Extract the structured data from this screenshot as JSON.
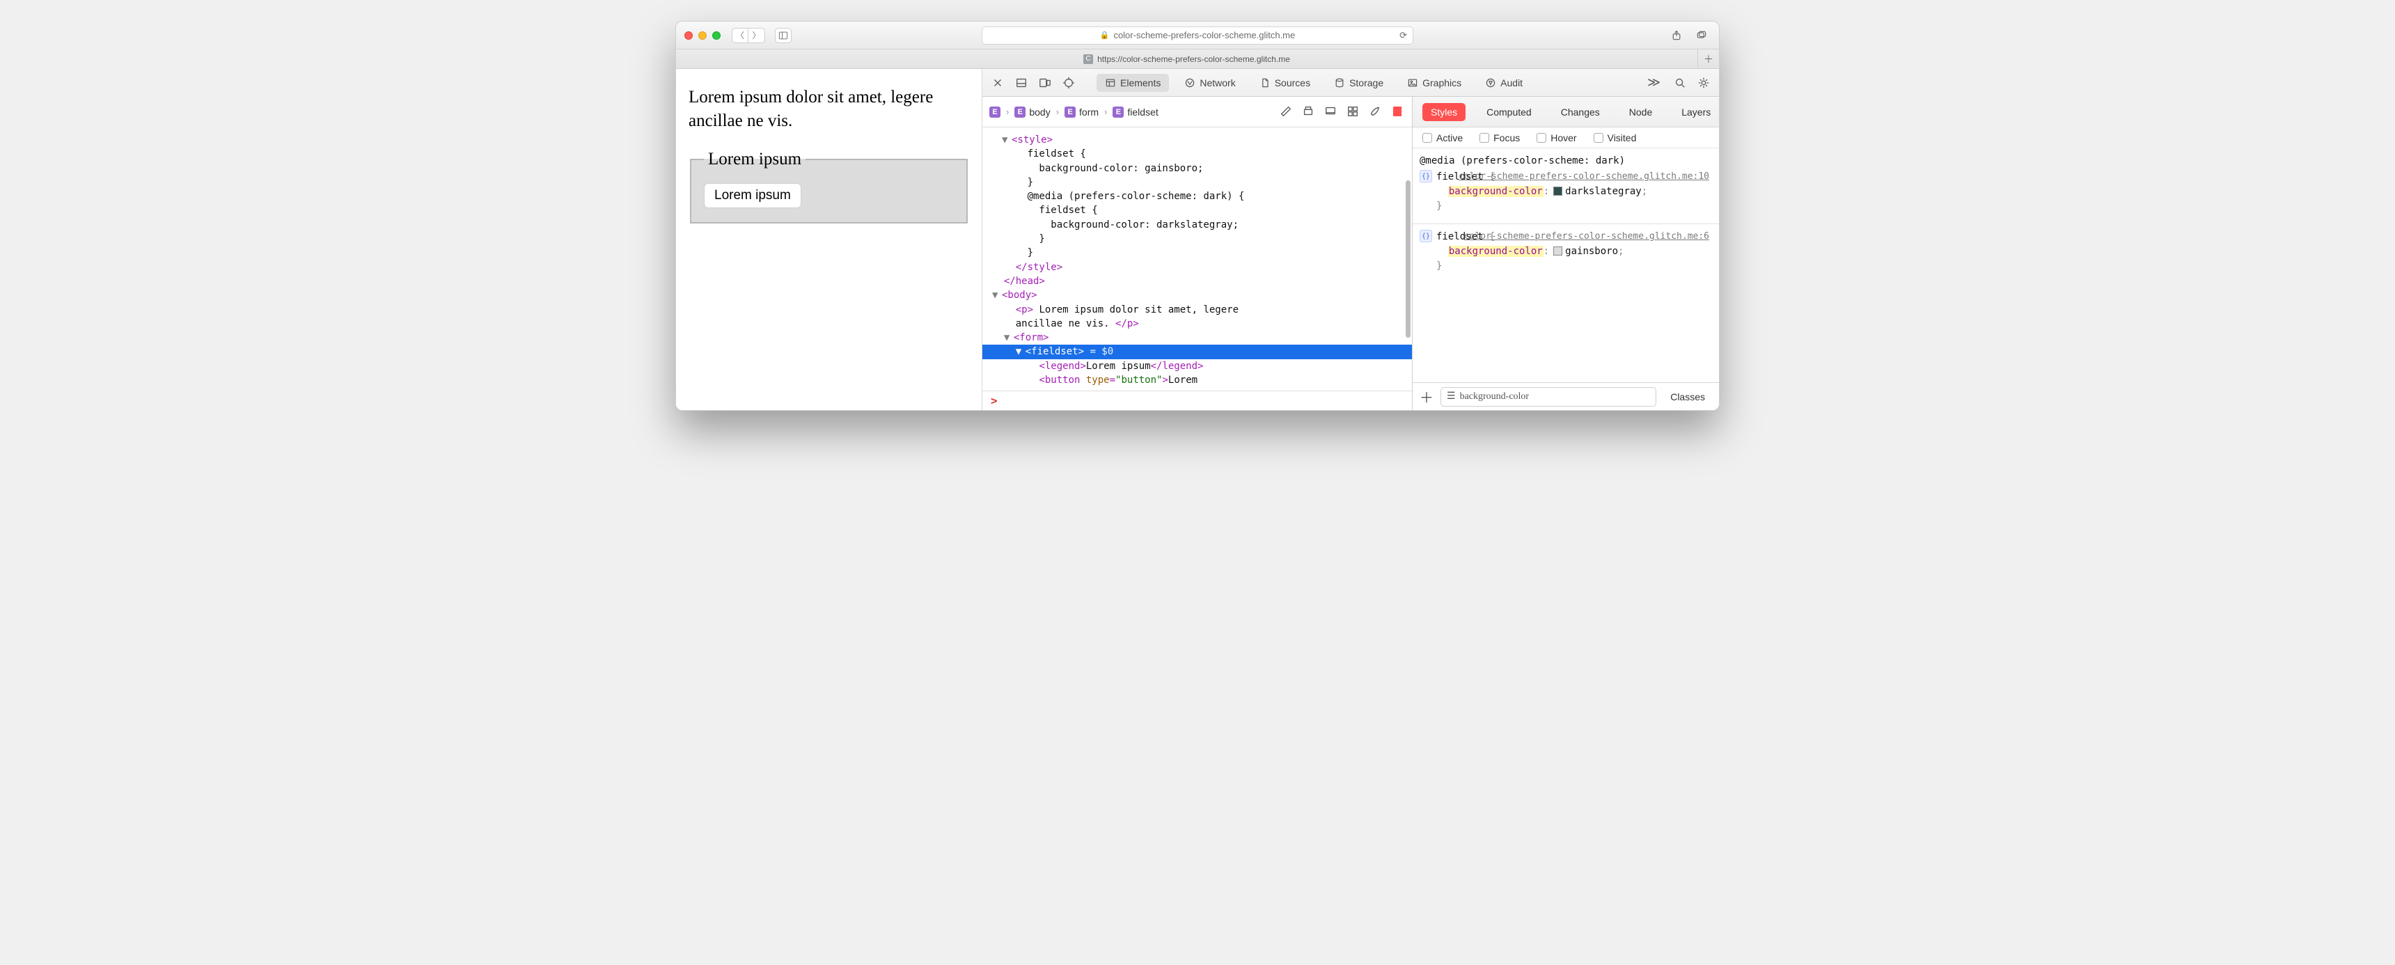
{
  "titlebar": {
    "url_host": "color-scheme-prefers-color-scheme.glitch.me"
  },
  "tabbar": {
    "tab_favicon_letter": "C",
    "tab_label": "https://color-scheme-prefers-color-scheme.glitch.me"
  },
  "page": {
    "paragraph": "Lorem ipsum dolor sit amet, legere ancillae ne vis.",
    "legend": "Lorem ipsum",
    "button": "Lorem ipsum"
  },
  "devtools": {
    "tabs": {
      "elements": "Elements",
      "network": "Network",
      "sources": "Sources",
      "storage": "Storage",
      "graphics": "Graphics",
      "audit": "Audit"
    },
    "breadcrumb": {
      "b0": "",
      "b1": "body",
      "b2": "form",
      "b3": "fieldset"
    },
    "dom": {
      "l0": "▼ <style>",
      "l1": "      fieldset {",
      "l2": "        background-color: gainsboro;",
      "l3": "      }",
      "l4": "      @media (prefers-color-scheme: dark) {",
      "l5": "        fieldset {",
      "l6": "          background-color: darkslategray;",
      "l7": "        }",
      "l8": "      }",
      "l9": "    </style>",
      "l10": "  </head>",
      "l11": "▼ <body>",
      "l12a": "    <p>",
      "l12b": " Lorem ipsum dolor sit amet, legere",
      "l13": "    ancillae ne vis. ",
      "l13b": "</p>",
      "l14": "  ▼ <form>",
      "l15a": "    ▼ ",
      "l15b": "<fieldset>",
      "l15c": " = $0",
      "l16a": "        <legend>",
      "l16b": "Lorem ipsum",
      "l16c": "</legend>",
      "l17a": "        <button ",
      "l17b": "type",
      "l17c": "=",
      "l17d": "\"button\"",
      "l17e": ">",
      "l17f": "Lorem"
    },
    "console_prompt": ">"
  },
  "styles": {
    "tabs": {
      "styles": "Styles",
      "computed": "Computed",
      "changes": "Changes",
      "node": "Node",
      "layers": "Layers"
    },
    "force": {
      "active": "Active",
      "focus": "Focus",
      "hover": "Hover",
      "visited": "Visited"
    },
    "rule1": {
      "media": "@media (prefers-color-scheme: dark)",
      "src": "color-scheme-prefers-color-scheme.glitch.me:10",
      "selector": "fieldset",
      "prop": "background-color",
      "value": "darkslategray",
      "swatch": "#2f4f4f"
    },
    "rule2": {
      "src": "color-scheme-prefers-color-scheme.glitch.me:6",
      "selector": "fieldset",
      "prop": "background-color",
      "value": "gainsboro",
      "swatch": "#dcdcdc"
    },
    "footer": {
      "filter_value": "background-color",
      "classes": "Classes"
    }
  }
}
